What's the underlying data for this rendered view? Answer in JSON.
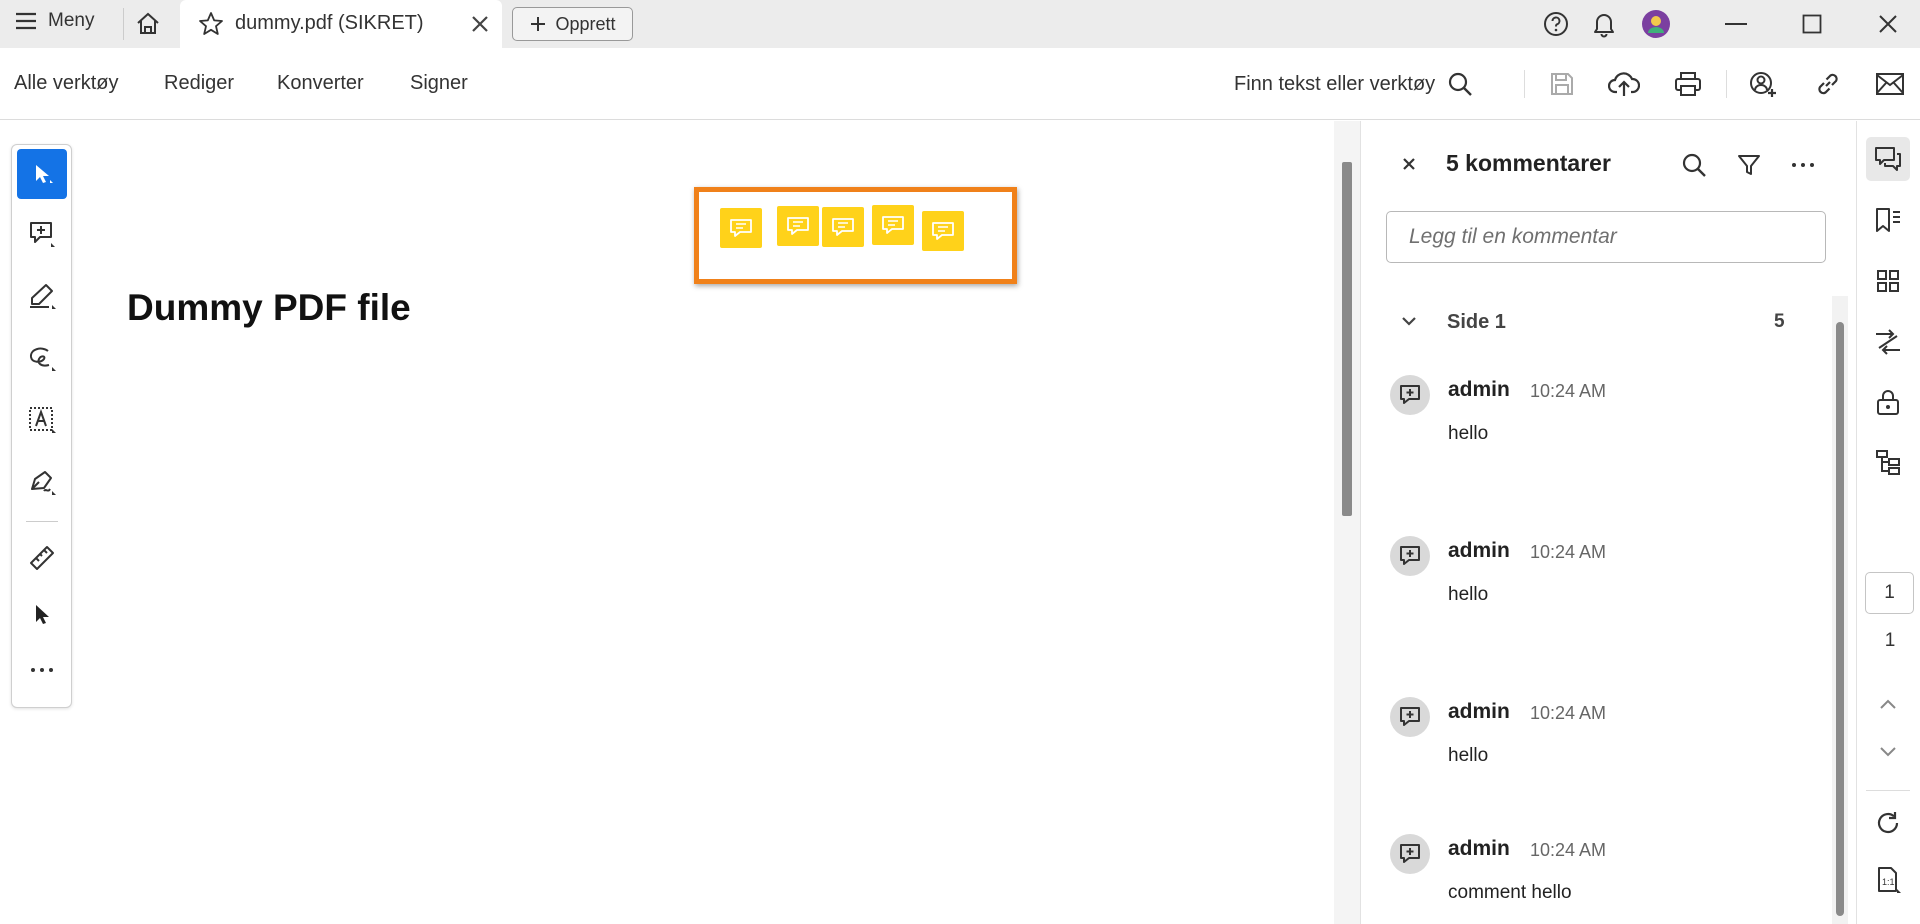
{
  "titlebar": {
    "menu_label": "Meny",
    "tab_title": "dummy.pdf (SIKRET)",
    "create_label": "Opprett"
  },
  "toolbar": {
    "menu": [
      "Alle verktøy",
      "Rediger",
      "Konverter",
      "Signer"
    ],
    "search_label": "Finn tekst eller verktøy"
  },
  "document": {
    "title": "Dummy PDF file"
  },
  "comments_panel": {
    "title": "5 kommentarer",
    "input_placeholder": "Legg til en kommentar",
    "page_group": "Side 1",
    "page_count": "5",
    "comments": [
      {
        "author": "admin",
        "time": "10:24 AM",
        "text": "hello"
      },
      {
        "author": "admin",
        "time": "10:24 AM",
        "text": "hello"
      },
      {
        "author": "admin",
        "time": "10:24 AM",
        "text": "hello"
      },
      {
        "author": "admin",
        "time": "10:24 AM",
        "text": "comment hello"
      }
    ]
  },
  "page_nav": {
    "current": "1",
    "total": "1"
  },
  "colors": {
    "accent": "#1473e6",
    "sticky_note": "#ffd21a",
    "highlight_border": "#f0811a",
    "avatar": "#7b3fa0"
  }
}
